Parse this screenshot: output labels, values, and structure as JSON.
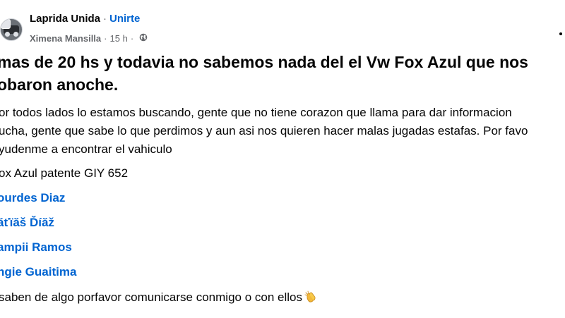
{
  "post": {
    "group_name": "Laprida Unida",
    "separator": "·",
    "join_label": "Unirte",
    "author": "Ximena Mansilla",
    "time": "15 h",
    "meta_dot": "·",
    "headline_1": "mas de 20 hs y todavia no sabemos nada del el Vw Fox Azul que nos",
    "headline_2": "obaron anoche.",
    "body_line_1": "or todos lados lo estamos buscando, gente que no tiene corazon que llama para dar informacion",
    "body_line_2": "ucha, gente que sabe lo que perdimos y aun asi nos quieren hacer malas jugadas estafas. Por favo",
    "body_line_3": "yudenme a encontrar el vahiculo",
    "car_line": "ox Azul patente GIY 652",
    "mentions": [
      "ourdes Diaz",
      "ăťïăš Ďíăž",
      "ampii Ramos",
      "ngie Guaitima"
    ],
    "closing": "saben de algo porfavor comunicarse conmigo o con ellos"
  },
  "icons": {
    "privacy": "globe-icon",
    "menu": "more-options-icon",
    "emoji": "clapping-hands-icon"
  },
  "colors": {
    "link": "#0064d1",
    "secondary_text": "#65676b",
    "primary_text": "#050505"
  }
}
